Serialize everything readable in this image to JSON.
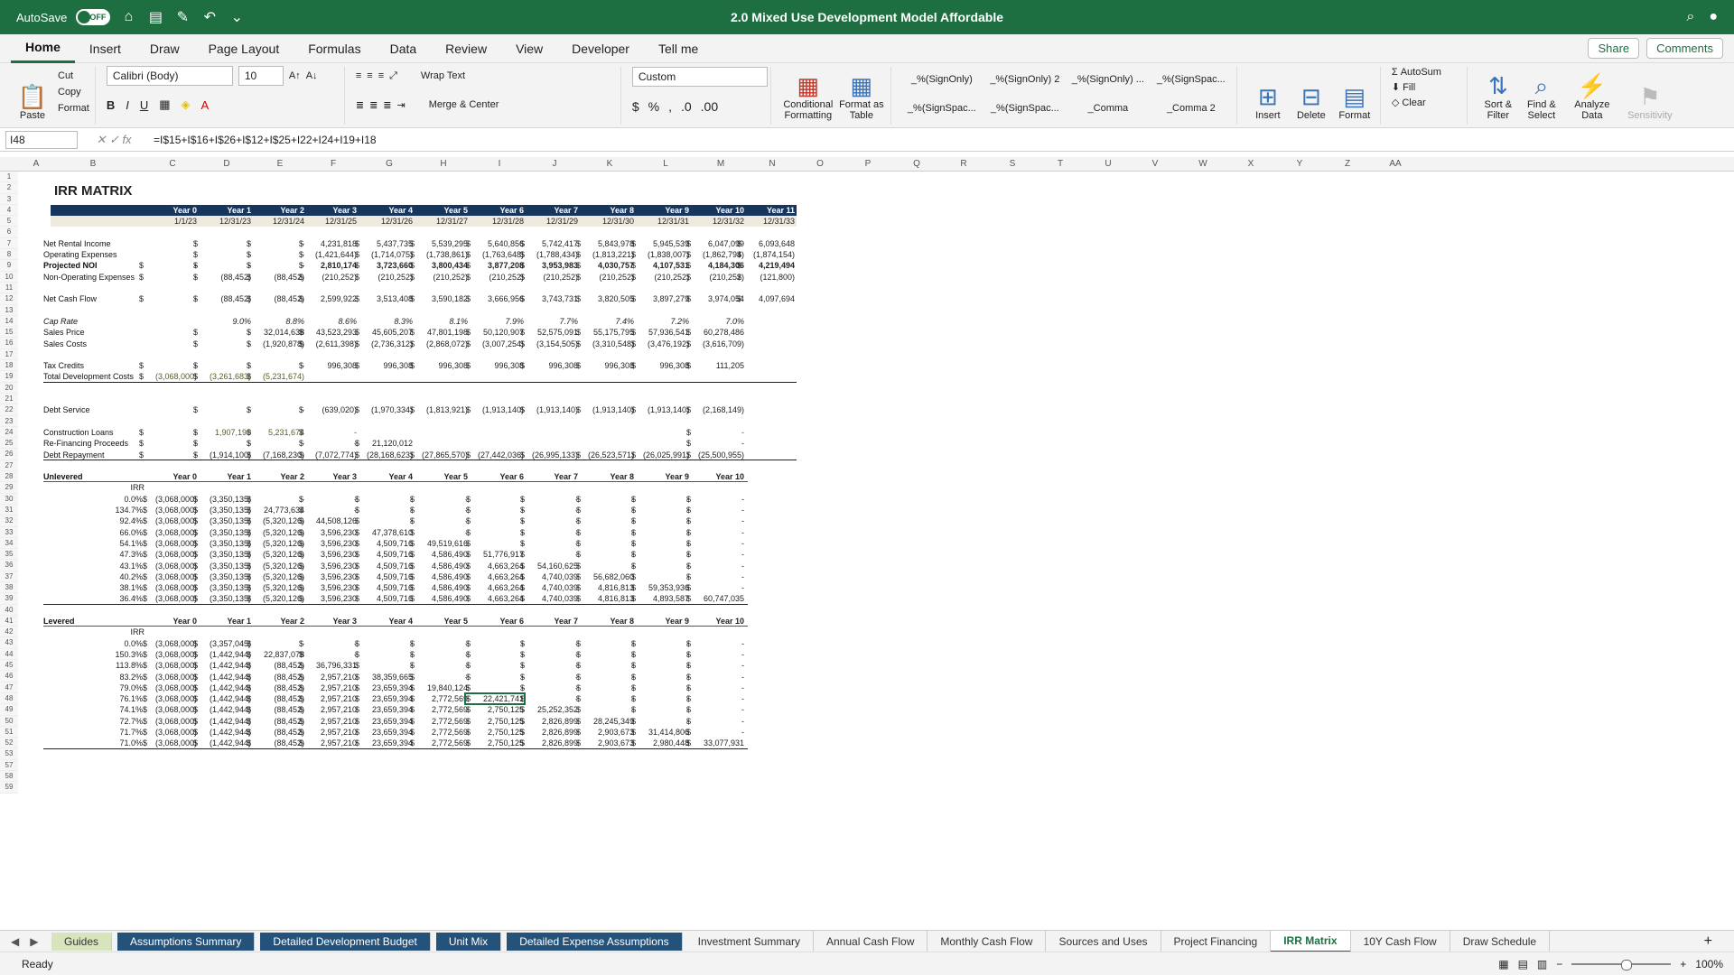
{
  "titlebar": {
    "autosave": "AutoSave",
    "toggle": "OFF",
    "title": "2.0 Mixed Use Development Model Affordable"
  },
  "menu": [
    "Home",
    "Insert",
    "Draw",
    "Page Layout",
    "Formulas",
    "Data",
    "Review",
    "View",
    "Developer",
    "Tell me"
  ],
  "share": {
    "share": "Share",
    "comments": "Comments"
  },
  "ribbon": {
    "paste": "Paste",
    "cut": "Cut",
    "copy": "Copy",
    "format": "Format",
    "font": "Calibri (Body)",
    "size": "10",
    "wrap": "Wrap Text",
    "merge": "Merge & Center",
    "numfmt": "Custom",
    "cond": "Conditional Formatting",
    "fmttable": "Format as Table",
    "styles": [
      "_%(SignOnly)",
      "_%(SignOnly) 2",
      "_%(SignOnly) ...",
      "_%(SignSpac...",
      "_%(SignSpac...",
      "_%(SignSpac...",
      "_Comma",
      "_Comma 2"
    ],
    "insert": "Insert",
    "delete": "Delete",
    "formatc": "Format",
    "autosum": "AutoSum",
    "fill": "Fill",
    "clear": "Clear",
    "sort": "Sort & Filter",
    "find": "Find & Select",
    "analyze": "Analyze Data",
    "sens": "Sensitivity"
  },
  "formula_bar": {
    "cell": "I48",
    "formula": "=I$15+I$16+I$26+I$12+I$25+I22+I24+I19+I18"
  },
  "columns": [
    "A",
    "B",
    "C",
    "D",
    "E",
    "F",
    "G",
    "H",
    "I",
    "J",
    "K",
    "L",
    "M",
    "N",
    "O",
    "P",
    "Q",
    "R",
    "S",
    "T",
    "U",
    "V",
    "W",
    "X",
    "Y",
    "Z",
    "AA"
  ],
  "title": "IRR MATRIX",
  "years": [
    "Year 0",
    "Year 1",
    "Year 2",
    "Year 3",
    "Year 4",
    "Year 5",
    "Year 6",
    "Year 7",
    "Year 8",
    "Year 9",
    "Year 10",
    "Year 11"
  ],
  "dates": [
    "1/1/23",
    "12/31/23",
    "12/31/24",
    "12/31/25",
    "12/31/26",
    "12/31/27",
    "12/31/28",
    "12/31/29",
    "12/31/30",
    "12/31/31",
    "12/31/32",
    "12/31/33"
  ],
  "rows": [
    {
      "r": 7,
      "label": "Net Rental Income",
      "v": [
        "",
        "-",
        "-",
        "4,231,818",
        "5,437,735",
        "5,539,295",
        "5,640,856",
        "5,742,417",
        "5,843,978",
        "5,945,539",
        "6,047,099",
        "6,093,648"
      ]
    },
    {
      "r": 8,
      "label": "Operating Expenses",
      "v": [
        "",
        "-",
        "-",
        "(1,421,644)",
        "(1,714,075)",
        "(1,738,861)",
        "(1,763,648)",
        "(1,788,434)",
        "(1,813,221)",
        "(1,838,007)",
        "(1,862,794)",
        "(1,874,154)"
      ]
    },
    {
      "r": 9,
      "label": "Projected NOI",
      "v": [
        "-",
        "-",
        "-",
        "2,810,174",
        "3,723,660",
        "3,800,434",
        "3,877,208",
        "3,953,983",
        "4,030,757",
        "4,107,531",
        "4,184,306",
        "4,219,494"
      ]
    },
    {
      "r": 10,
      "label": "Non-Operating Expenses",
      "v": [
        "-",
        "(88,452)",
        "(88,452)",
        "(210,252)",
        "(210,252)",
        "(210,252)",
        "(210,252)",
        "(210,252)",
        "(210,252)",
        "(210,252)",
        "(210,252)",
        "(121,800)"
      ]
    },
    {
      "r": 12,
      "label": "Net Cash Flow",
      "v": [
        "-",
        "(88,452)",
        "(88,452)",
        "2,599,922",
        "3,513,408",
        "3,590,182",
        "3,666,956",
        "3,743,731",
        "3,820,505",
        "3,897,279",
        "3,974,054",
        "4,097,694"
      ]
    },
    {
      "r": 14,
      "label": "Cap Rate",
      "v": [
        "",
        "9.0%",
        "8.8%",
        "8.6%",
        "8.3%",
        "8.1%",
        "7.9%",
        "7.7%",
        "7.4%",
        "7.2%",
        "7.0%",
        ""
      ]
    },
    {
      "r": 15,
      "label": "Sales Price",
      "v": [
        "",
        "-",
        "32,014,638",
        "43,523,293",
        "45,605,207",
        "47,801,198",
        "50,120,907",
        "52,575,091",
        "55,175,795",
        "57,936,541",
        "60,278,486",
        ""
      ]
    },
    {
      "r": 16,
      "label": "Sales Costs",
      "v": [
        "",
        "-",
        "(1,920,878)",
        "(2,611,398)",
        "(2,736,312)",
        "(2,868,072)",
        "(3,007,254)",
        "(3,154,505)",
        "(3,310,548)",
        "(3,476,192)",
        "(3,616,709)",
        ""
      ]
    },
    {
      "r": 18,
      "label": "Tax Credits",
      "v": [
        "-",
        "-",
        "-",
        "996,308",
        "996,308",
        "996,308",
        "996,308",
        "996,308",
        "996,308",
        "996,308",
        "111,205",
        ""
      ]
    },
    {
      "r": 19,
      "label": "Total Development Costs",
      "v": [
        "(3,068,000)",
        "(3,261,683)",
        "(5,231,674)",
        "",
        "",
        "",
        "",
        "",
        "",
        "",
        "",
        ""
      ]
    },
    {
      "r": 22,
      "label": "Debt Service",
      "v": [
        "",
        "-",
        "-",
        "(639,020)",
        "(1,970,334)",
        "(1,813,921)",
        "(1,913,140)",
        "(1,913,140)",
        "(1,913,140)",
        "(1,913,140)",
        "(2,168,149)",
        ""
      ]
    },
    {
      "r": 24,
      "label": "Construction Loans",
      "v": [
        "-",
        "1,907,190",
        "5,231,674",
        "-",
        "",
        "",
        "",
        "",
        "",
        "",
        "-",
        ""
      ]
    },
    {
      "r": 25,
      "label": "Re-Financing Proceeds",
      "v": [
        "-",
        "-",
        "-",
        "-",
        "21,120,012",
        "",
        "",
        "",
        "",
        "",
        "-",
        ""
      ]
    },
    {
      "r": 26,
      "label": "Debt Repayment",
      "v": [
        "-",
        "(1,914,100)",
        "(7,168,230)",
        "(7,072,774)",
        "(28,168,623)",
        "(27,865,570)",
        "(27,442,036)",
        "(26,995,133)",
        "(26,523,571)",
        "(26,025,991)",
        "(25,500,955)",
        ""
      ]
    }
  ],
  "unlevered": {
    "label": "Unlevered",
    "irr": "IRR",
    "matrix": [
      [
        "0.0%",
        "(3,068,000)",
        "(3,350,135)",
        "-",
        "-",
        "-",
        "-",
        "-",
        "-",
        "-",
        "-",
        "-"
      ],
      [
        "134.7%",
        "(3,068,000)",
        "(3,350,135)",
        "24,773,634",
        "-",
        "-",
        "-",
        "-",
        "-",
        "-",
        "-",
        "-"
      ],
      [
        "92.4%",
        "(3,068,000)",
        "(3,350,135)",
        "(5,320,126)",
        "44,508,126",
        "-",
        "-",
        "-",
        "-",
        "-",
        "-",
        "-"
      ],
      [
        "66.0%",
        "(3,068,000)",
        "(3,350,135)",
        "(5,320,126)",
        "3,596,230",
        "47,378,610",
        "-",
        "-",
        "-",
        "-",
        "-",
        "-"
      ],
      [
        "54.1%",
        "(3,068,000)",
        "(3,350,135)",
        "(5,320,126)",
        "3,596,230",
        "4,509,716",
        "49,519,616",
        "-",
        "-",
        "-",
        "-",
        "-"
      ],
      [
        "47.3%",
        "(3,068,000)",
        "(3,350,135)",
        "(5,320,126)",
        "3,596,230",
        "4,509,716",
        "4,586,490",
        "51,776,917",
        "-",
        "-",
        "-",
        "-"
      ],
      [
        "43.1%",
        "(3,068,000)",
        "(3,350,135)",
        "(5,320,126)",
        "3,596,230",
        "4,509,716",
        "4,586,490",
        "4,663,264",
        "54,160,625",
        "-",
        "-",
        "-"
      ],
      [
        "40.2%",
        "(3,068,000)",
        "(3,350,135)",
        "(5,320,126)",
        "3,596,230",
        "4,509,716",
        "4,586,490",
        "4,663,264",
        "4,740,039",
        "56,682,060",
        "-",
        "-"
      ],
      [
        "38.1%",
        "(3,068,000)",
        "(3,350,135)",
        "(5,320,126)",
        "3,596,230",
        "4,509,716",
        "4,586,490",
        "4,663,264",
        "4,740,039",
        "4,816,813",
        "59,353,936",
        "-"
      ],
      [
        "36.4%",
        "(3,068,000)",
        "(3,350,135)",
        "(5,320,126)",
        "3,596,230",
        "4,509,716",
        "4,586,490",
        "4,663,264",
        "4,740,039",
        "4,816,813",
        "4,893,587",
        "60,747,035"
      ]
    ]
  },
  "levered": {
    "label": "Levered",
    "irr": "IRR",
    "matrix": [
      [
        "0.0%",
        "(3,068,000)",
        "(3,357,045)",
        "-",
        "-",
        "-",
        "-",
        "-",
        "-",
        "-",
        "-",
        "-"
      ],
      [
        "150.3%",
        "(3,068,000)",
        "(1,442,944)",
        "22,837,078",
        "-",
        "-",
        "-",
        "-",
        "-",
        "-",
        "-",
        "-"
      ],
      [
        "113.8%",
        "(3,068,000)",
        "(1,442,944)",
        "(88,452)",
        "36,796,331",
        "-",
        "-",
        "-",
        "-",
        "-",
        "-",
        "-"
      ],
      [
        "83.2%",
        "(3,068,000)",
        "(1,442,944)",
        "(88,452)",
        "2,957,210",
        "38,359,665",
        "-",
        "-",
        "-",
        "-",
        "-",
        "-"
      ],
      [
        "79.0%",
        "(3,068,000)",
        "(1,442,944)",
        "(88,452)",
        "2,957,210",
        "23,659,394",
        "19,840,124",
        "-",
        "-",
        "-",
        "-",
        "-"
      ],
      [
        "76.1%",
        "(3,068,000)",
        "(1,442,944)",
        "(88,452)",
        "2,957,210",
        "23,659,394",
        "2,772,569",
        "22,421,741",
        "-",
        "-",
        "-",
        "-"
      ],
      [
        "74.1%",
        "(3,068,000)",
        "(1,442,944)",
        "(88,452)",
        "2,957,210",
        "23,659,394",
        "2,772,569",
        "2,750,125",
        "25,252,352",
        "-",
        "-",
        "-"
      ],
      [
        "72.7%",
        "(3,068,000)",
        "(1,442,944)",
        "(88,452)",
        "2,957,210",
        "23,659,394",
        "2,772,569",
        "2,750,125",
        "2,826,899",
        "28,245,349",
        "-",
        "-"
      ],
      [
        "71.7%",
        "(3,068,000)",
        "(1,442,944)",
        "(88,452)",
        "2,957,210",
        "23,659,394",
        "2,772,569",
        "2,750,125",
        "2,826,899",
        "2,903,673",
        "31,414,806",
        "-"
      ],
      [
        "71.0%",
        "(3,068,000)",
        "(1,442,944)",
        "(88,452)",
        "2,957,210",
        "23,659,394",
        "2,772,569",
        "2,750,125",
        "2,826,899",
        "2,903,673",
        "2,980,448",
        "33,077,931"
      ]
    ]
  },
  "sheet_tabs": [
    "Guides",
    "Assumptions Summary",
    "Detailed Development Budget",
    "Unit Mix",
    "Detailed Expense Assumptions",
    "Investment Summary",
    "Annual Cash Flow",
    "Monthly Cash Flow",
    "Sources and Uses",
    "Project Financing",
    "IRR Matrix",
    "10Y Cash Flow",
    "Draw Schedule"
  ],
  "status": {
    "ready": "Ready",
    "zoom": "100%"
  }
}
